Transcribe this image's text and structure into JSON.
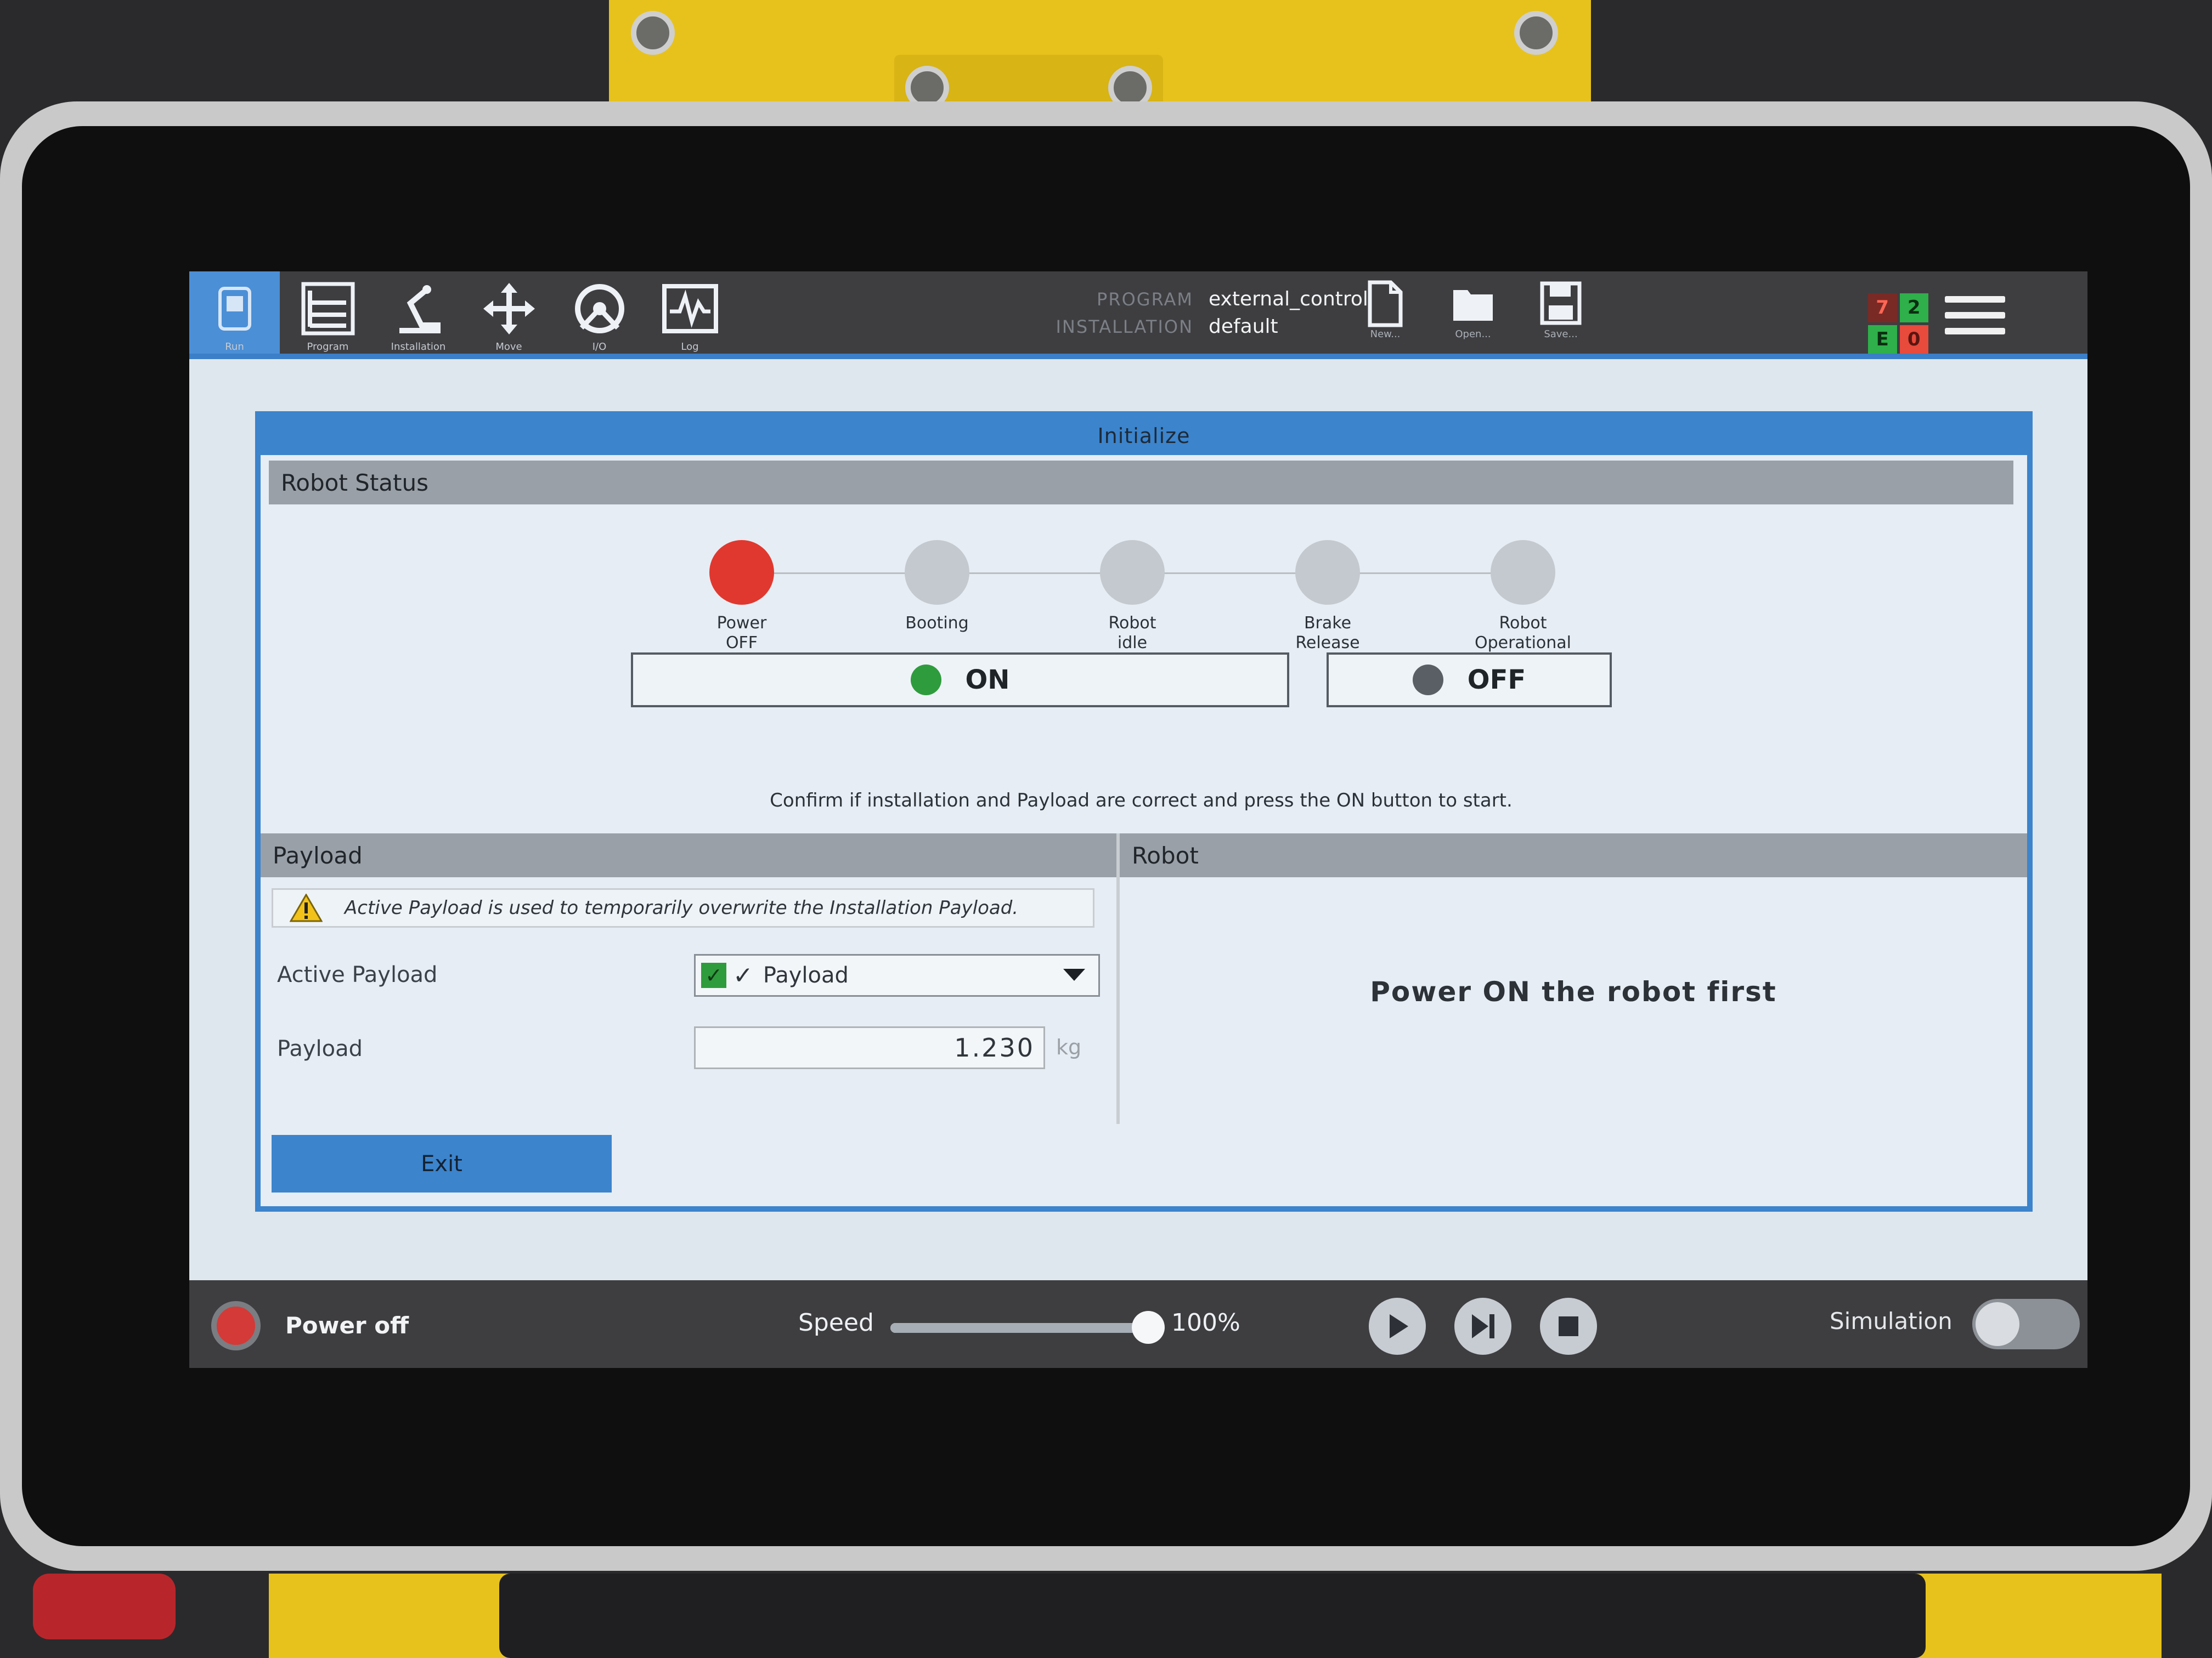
{
  "topbar": {
    "nav": [
      {
        "name": "nav-run",
        "label": "Run",
        "icon": "run-icon",
        "active": true
      },
      {
        "name": "nav-program",
        "label": "Program",
        "icon": "program-icon"
      },
      {
        "name": "nav-installation",
        "label": "Installation",
        "icon": "installation-icon"
      },
      {
        "name": "nav-move",
        "label": "Move",
        "icon": "move-icon"
      },
      {
        "name": "nav-io",
        "label": "I/O",
        "icon": "io-icon"
      },
      {
        "name": "nav-log",
        "label": "Log",
        "icon": "log-icon"
      }
    ],
    "program_key": "PROGRAM",
    "program_value": "external_control",
    "installation_key": "INSTALLATION",
    "installation_value": "default",
    "file_buttons": [
      {
        "label": "New...",
        "icon": "new-file-icon"
      },
      {
        "label": "Open...",
        "icon": "open-folder-icon"
      },
      {
        "label": "Save...",
        "icon": "save-disk-icon"
      }
    ],
    "status_grid": {
      "cells": [
        "7",
        "2",
        "E",
        "0"
      ],
      "colors": [
        "#e84a3c",
        "#2fb04a",
        "#2fb04a",
        "#e84a3c"
      ]
    },
    "menu_icon": "hamburger-menu-icon"
  },
  "dialog": {
    "title": "Initialize",
    "robot_status": {
      "header": "Robot Status",
      "steps": [
        {
          "label": "Power\nOFF",
          "color": "#e0382f"
        },
        {
          "label": "Booting",
          "color": "#c4c9cf"
        },
        {
          "label": "Robot\nidle",
          "color": "#c4c9cf"
        },
        {
          "label": "Brake\nRelease",
          "color": "#c4c9cf"
        },
        {
          "label": "Robot\nOperational",
          "color": "#c4c9cf"
        }
      ],
      "on_button": "ON",
      "off_button": "OFF",
      "on_indicator_color": "#2e9c3c",
      "off_indicator_color": "#5a5f66",
      "confirm_text": "Confirm if installation and Payload are correct and press the ON button to start."
    },
    "payload": {
      "header": "Payload",
      "warning": "Active Payload is used to temporarily overwrite the Installation Payload.",
      "active_payload_label": "Active Payload",
      "active_payload_value": "Payload",
      "payload_label": "Payload",
      "payload_value": "1.230",
      "payload_unit": "kg"
    },
    "robot": {
      "header": "Robot",
      "message": "Power ON the robot first"
    },
    "exit_button": "Exit"
  },
  "footer": {
    "power_label": "Power off",
    "speed_label": "Speed",
    "speed_value": "100%",
    "speed_fraction": 1.0,
    "simulation_label": "Simulation",
    "simulation_on": false
  }
}
